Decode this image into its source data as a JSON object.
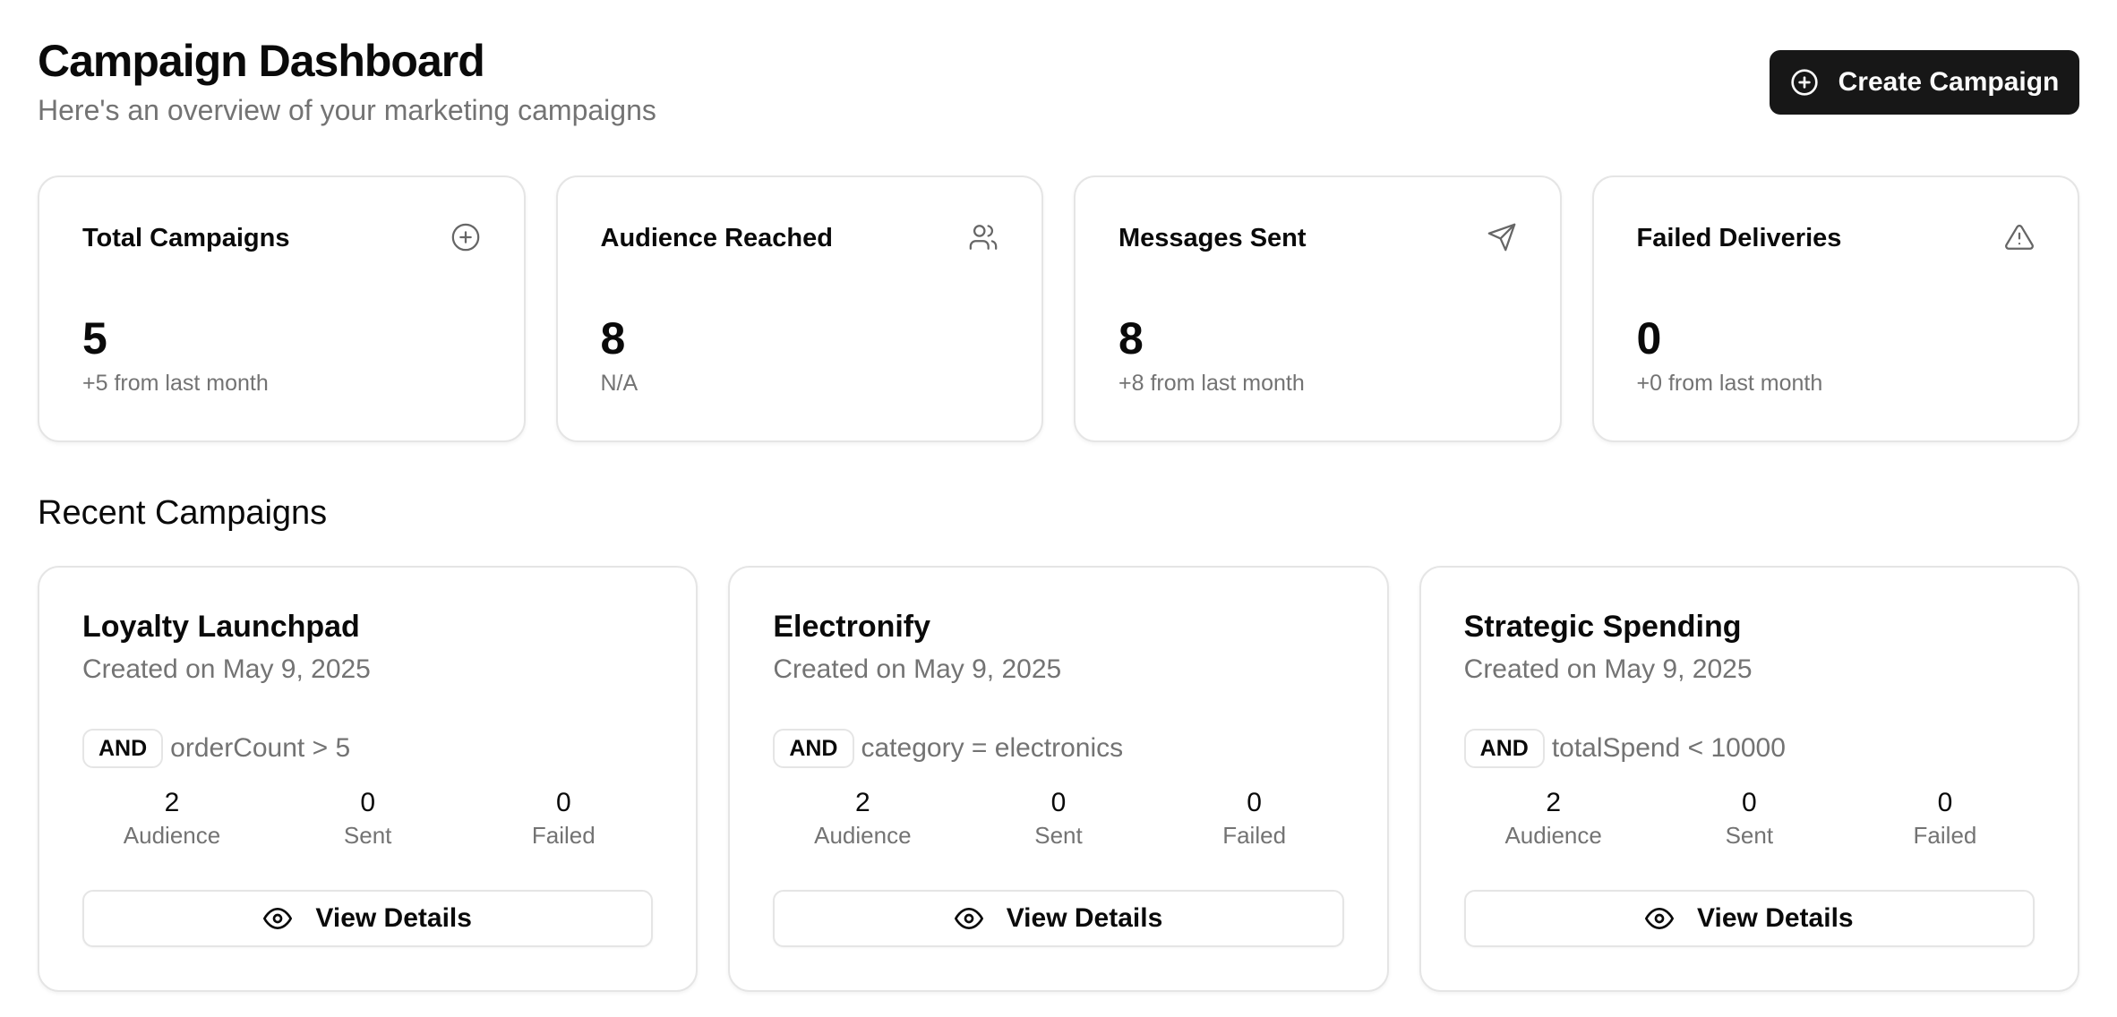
{
  "header": {
    "title": "Campaign Dashboard",
    "subtitle": "Here's an overview of your marketing campaigns",
    "create_button": {
      "label": "Create Campaign",
      "icon": "plus-circle-icon"
    }
  },
  "stats": [
    {
      "title": "Total Campaigns",
      "value": "5",
      "sub": "+5 from last month",
      "icon": "plus-circle-icon"
    },
    {
      "title": "Audience Reached",
      "value": "8",
      "sub": "N/A",
      "icon": "users-icon"
    },
    {
      "title": "Messages Sent",
      "value": "8",
      "sub": "+8 from last month",
      "icon": "send-icon"
    },
    {
      "title": "Failed Deliveries",
      "value": "0",
      "sub": "+0 from last month",
      "icon": "alert-triangle-icon"
    }
  ],
  "recent": {
    "title": "Recent Campaigns",
    "campaigns": [
      {
        "name": "Loyalty Launchpad",
        "date": "Created on May 9, 2025",
        "rule_op": "AND",
        "rule": "orderCount > 5",
        "audience": "2",
        "sent": "0",
        "failed": "0",
        "audience_label": "Audience",
        "sent_label": "Sent",
        "failed_label": "Failed",
        "button_label": "View Details"
      },
      {
        "name": "Electronify",
        "date": "Created on May 9, 2025",
        "rule_op": "AND",
        "rule": "category = electronics",
        "audience": "2",
        "sent": "0",
        "failed": "0",
        "audience_label": "Audience",
        "sent_label": "Sent",
        "failed_label": "Failed",
        "button_label": "View Details"
      },
      {
        "name": "Strategic Spending",
        "date": "Created on May 9, 2025",
        "rule_op": "AND",
        "rule": "totalSpend < 10000",
        "audience": "2",
        "sent": "0",
        "failed": "0",
        "audience_label": "Audience",
        "sent_label": "Sent",
        "failed_label": "Failed",
        "button_label": "View Details"
      }
    ]
  },
  "colors": {
    "primary": "#171717",
    "muted_text": "#737373",
    "border": "#e5e5e5"
  }
}
